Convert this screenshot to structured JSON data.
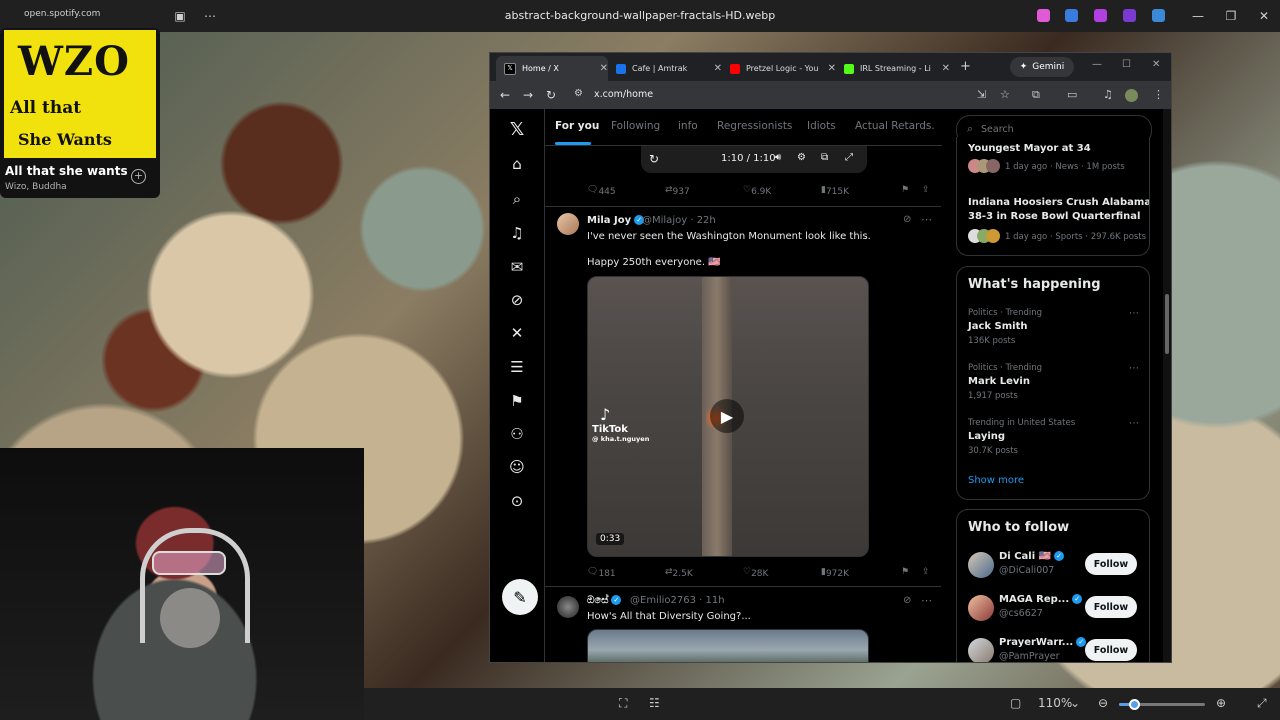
{
  "viewer": {
    "url_hint": "open.spotify.com",
    "title": "abstract-background-wallpaper-fractals-HD.webp",
    "zoom": "110%"
  },
  "spotify": {
    "art_big": "WZO",
    "art_line1": "All that",
    "art_line2": "She Wants",
    "song": "All that she wants",
    "artist": "Wizo, Buddha"
  },
  "browser": {
    "tabs": [
      {
        "label": "Home / X",
        "color": "#000000"
      },
      {
        "label": "Cafe | Amtrak",
        "color": "#1a73e8"
      },
      {
        "label": "Pretzel Logic - You",
        "color": "#ff0000"
      },
      {
        "label": "IRL Streaming - Li",
        "color": "#53fc18"
      }
    ],
    "gemini": "Gemini",
    "url": "x.com/home"
  },
  "feed": {
    "tabs": [
      "For you",
      "Following",
      "info",
      "Regressionists",
      "Idiots",
      "Actual Retards."
    ],
    "video_time": "1:10 / 1:10",
    "tweets": [
      {
        "replies": "445",
        "retweets": "937",
        "likes": "6.9K",
        "views": "715K"
      },
      {
        "name": "Mila Joy",
        "handle": "@Milajoy",
        "time": "22h",
        "line1": "I've never seen the Washington Monument look like this.",
        "line2": "Happy 250th everyone. 🇺🇸",
        "tiktok": "TikTok",
        "tiktok_user": "@ kha.t.nguyen",
        "duration": "0:33",
        "replies": "181",
        "retweets": "2.5K",
        "likes": "28K",
        "views": "972K"
      },
      {
        "name": "ඔසේ",
        "handle": "@Emilio2763",
        "time": "11h",
        "line1": "How's All that Diversity Going?..."
      }
    ]
  },
  "rail": {
    "search_placeholder": "Search",
    "news": [
      {
        "title": "Youngest Mayor at 34",
        "meta": "1 day ago · News · 1M posts"
      },
      {
        "title_line1": "Indiana Hoosiers Crush Alabama",
        "title_line2": "38-3 in Rose Bowl Quarterfinal",
        "meta": "1 day ago · Sports · 297.6K posts"
      }
    ],
    "happening_title": "What's happening",
    "trends": [
      {
        "context": "Politics · Trending",
        "name": "Jack Smith",
        "posts": "136K posts"
      },
      {
        "context": "Politics · Trending",
        "name": "Mark Levin",
        "posts": "1,917 posts"
      },
      {
        "context": "Trending in United States",
        "name": "Laying",
        "posts": "30.7K posts"
      }
    ],
    "show_more": "Show more",
    "who_title": "Who to follow",
    "follow": [
      {
        "name": "Di Cali 🇺🇸",
        "handle": "@DiCali007",
        "button": "Follow"
      },
      {
        "name": "MAGA Rep...",
        "handle": "@cs6627",
        "button": "Follow"
      },
      {
        "name": "PrayerWarr...",
        "handle": "@PamPrayer",
        "button": "Follow"
      }
    ]
  }
}
